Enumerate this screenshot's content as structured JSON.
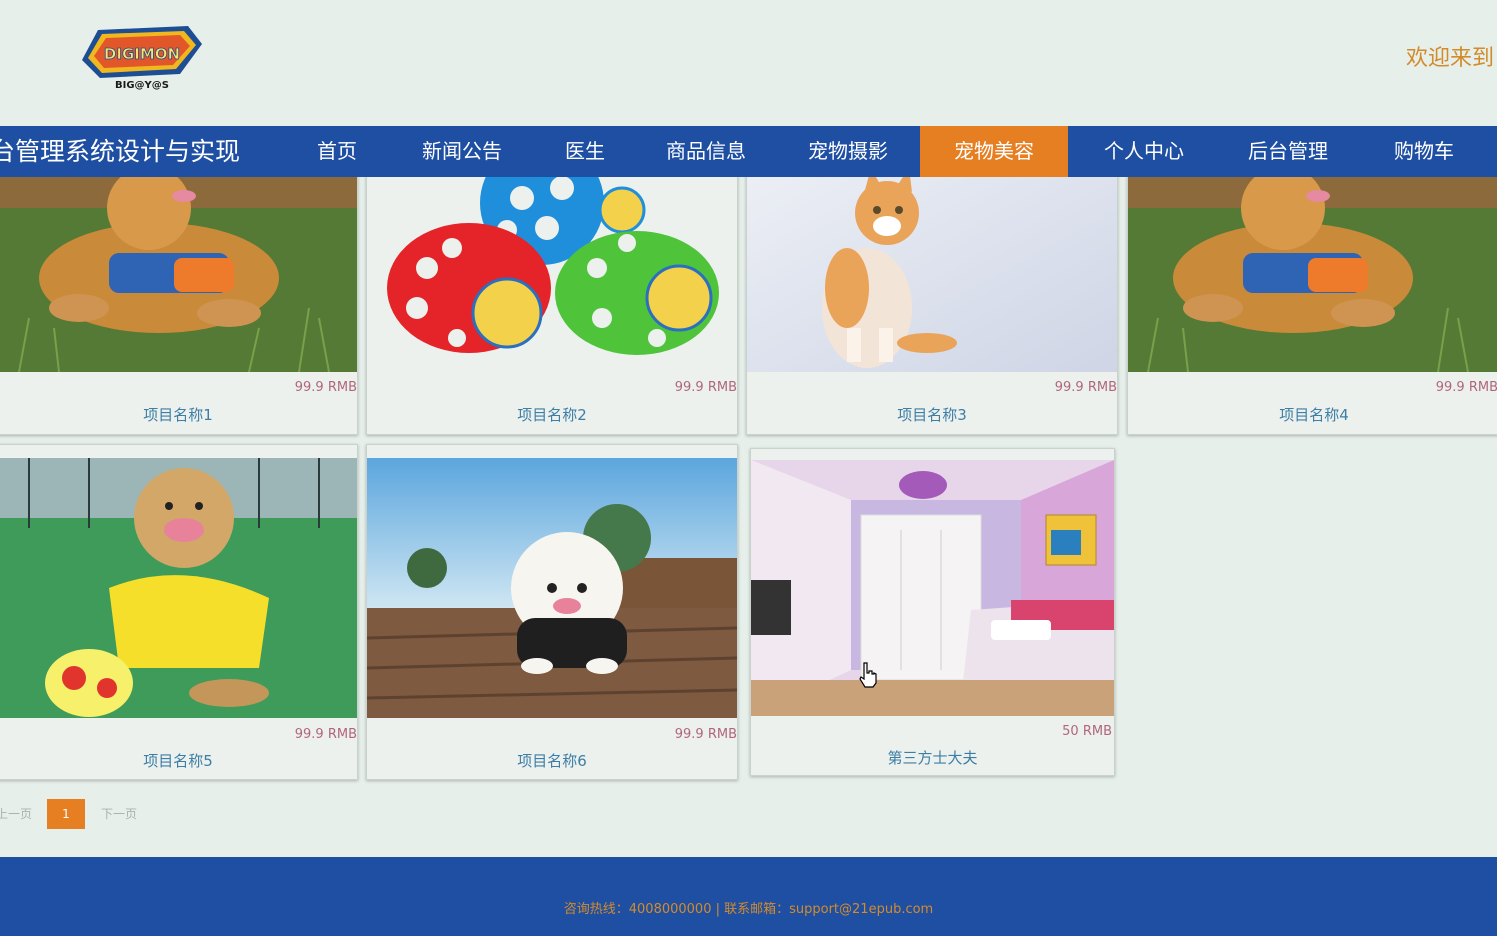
{
  "header": {
    "logo_alt": "BIG@Y@S",
    "welcome": "欢迎来到"
  },
  "nav": {
    "site_title": "台管理系统设计与实现",
    "items": [
      {
        "label": "首页"
      },
      {
        "label": "新闻公告"
      },
      {
        "label": "医生"
      },
      {
        "label": "商品信息"
      },
      {
        "label": "宠物摄影"
      },
      {
        "label": "宠物美容"
      },
      {
        "label": "个人中心"
      },
      {
        "label": "后台管理"
      },
      {
        "label": "购物车"
      }
    ],
    "active_index": 5
  },
  "products": [
    {
      "name": "项目名称1",
      "price": "99.9 RMB",
      "image": "golden-retriever-grass"
    },
    {
      "name": "项目名称2",
      "price": "99.9 RMB",
      "image": "pet-toy-balls"
    },
    {
      "name": "项目名称3",
      "price": "99.9 RMB",
      "image": "orange-white-cat"
    },
    {
      "name": "项目名称4",
      "price": "99.9 RMB",
      "image": "golden-retriever-grass"
    },
    {
      "name": "项目名称5",
      "price": "99.9 RMB",
      "image": "golden-retriever-football"
    },
    {
      "name": "项目名称6",
      "price": "99.9 RMB",
      "image": "bichon-dog-deck"
    },
    {
      "name": "第三方士大夫",
      "price": "50 RMB",
      "image": "pink-bedroom"
    }
  ],
  "pagination": {
    "prev": "上一页",
    "current": "1",
    "next": "下一页"
  },
  "footer": {
    "text": "咨询热线：4008000000 | 联系邮箱：support@21epub.com"
  },
  "colors": {
    "nav_bg": "#1f4fa3",
    "active": "#e67e22",
    "accent_text": "#d38b2a",
    "page_bg": "#e6efea"
  }
}
